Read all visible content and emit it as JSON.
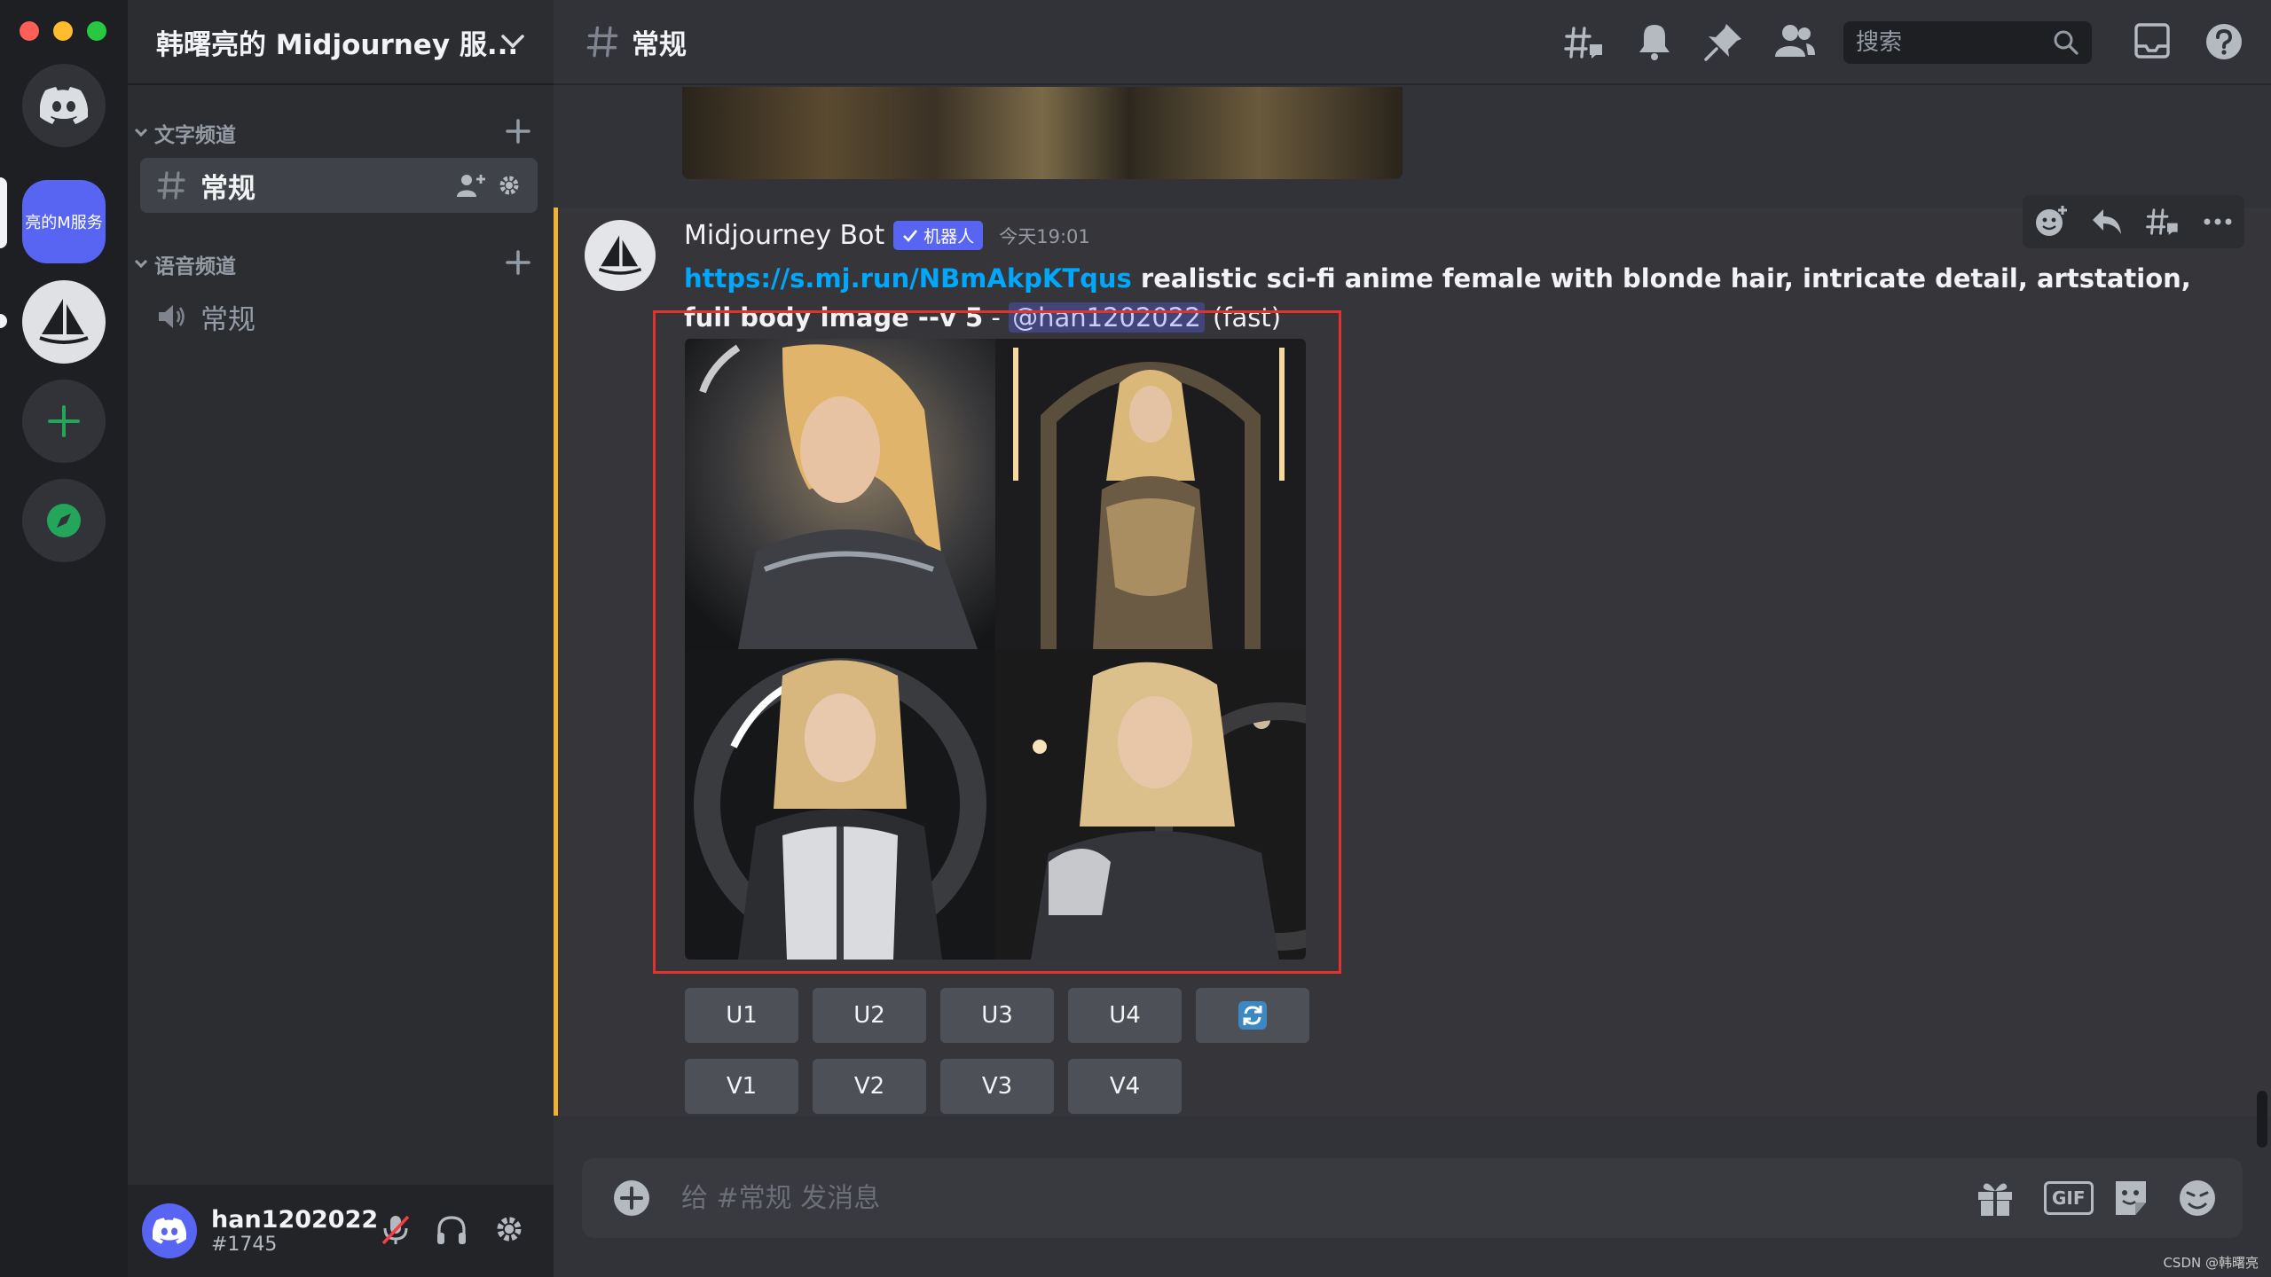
{
  "server": {
    "name": "韩曙亮的 Midjourney 服...",
    "badge_label": "亮的M服务"
  },
  "categories": {
    "text": "文字频道",
    "voice": "语音频道"
  },
  "channels": {
    "text_channel": "常规",
    "voice_channel": "常规"
  },
  "top_bar": {
    "channel_name": "常规",
    "search_placeholder": "搜索"
  },
  "message": {
    "author": "Midjourney Bot",
    "badge": "机器人",
    "timestamp": "今天19:01",
    "link": "https://s.mj.run/NBmAkpKTqus",
    "prompt": " realistic sci-fi anime female with blonde hair, intricate detail, artstation, full body image --v 5",
    "separator": " - ",
    "mention": "@han1202022",
    "speed": " (fast)"
  },
  "buttons": {
    "upscale": [
      "U1",
      "U2",
      "U3",
      "U4"
    ],
    "variation": [
      "V1",
      "V2",
      "V3",
      "V4"
    ]
  },
  "composer": {
    "placeholder": "给 #常规 发消息",
    "gif_label": "GIF"
  },
  "user": {
    "name": "han1202022",
    "tag": "#1745"
  },
  "watermark": "CSDN @韩曙亮",
  "colors": {
    "blurple": "#5865f2",
    "accent_bar": "#f0b232",
    "highlight_box": "#e2312e",
    "link": "#00a8fc",
    "green": "#23a55a"
  }
}
